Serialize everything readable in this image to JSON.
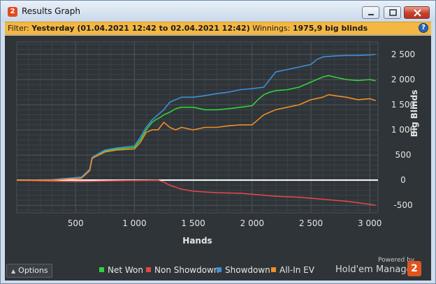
{
  "window": {
    "title": "Results Graph",
    "app_icon_glyph": "2",
    "app_icon_color": "#e24a1d",
    "controls": [
      "minimize-icon",
      "maximize-icon",
      "close-icon"
    ]
  },
  "filter": {
    "label": "Filter:",
    "value": "Yesterday (01.04.2021 12:42 to 02.04.2021 12:42)",
    "winnings_label": "Winnings:",
    "winnings_value": "1975,9 big blinds",
    "background_color": "#f3b844",
    "help_glyph": "?"
  },
  "options": {
    "label": "Options",
    "icon": "chevron-up-icon"
  },
  "branding": {
    "powered_by": "Powered by",
    "name": "Hold'em Manager",
    "logo_glyph": "2",
    "logo_color": "#e0541f"
  },
  "legend": [
    {
      "label": "Net Won",
      "color": "#34d13a"
    },
    {
      "label": "Non Showdown",
      "color": "#e0474c"
    },
    {
      "label": "Showdown",
      "color": "#3f8fd9"
    },
    {
      "label": "All-In EV",
      "color": "#ef8d2a"
    }
  ],
  "chart_data": {
    "type": "line",
    "xlabel": "Hands",
    "ylabel": "Big Blinds",
    "xlim": [
      0,
      3070
    ],
    "ylim": [
      -650,
      2750
    ],
    "x_ticks": [
      500,
      1000,
      1500,
      2000,
      2500,
      3000
    ],
    "x_tick_labels": [
      "500",
      "1 000",
      "1 500",
      "2 000",
      "2 500",
      "3 000"
    ],
    "y_ticks": [
      2500,
      2000,
      1500,
      1000,
      500,
      0,
      -500
    ],
    "y_tick_labels": [
      "2 500",
      "2 000",
      "1 500",
      "1 000",
      "500",
      "0",
      "-500"
    ],
    "y_axis_side": "right",
    "grid": true,
    "zero_line_color": "#ffffff",
    "background_color": "#2f3438",
    "series": [
      {
        "name": "Net Won",
        "color": "#34d13a",
        "x": [
          0,
          300,
          550,
          620,
          640,
          680,
          750,
          850,
          1000,
          1050,
          1100,
          1150,
          1180,
          1220,
          1250,
          1300,
          1350,
          1400,
          1500,
          1600,
          1700,
          1800,
          1900,
          2000,
          2050,
          2100,
          2150,
          2200,
          2300,
          2400,
          2500,
          2600,
          2650,
          2700,
          2800,
          2900,
          3000,
          3050
        ],
        "y": [
          0,
          0,
          50,
          200,
          450,
          500,
          580,
          620,
          650,
          800,
          1000,
          1150,
          1200,
          1250,
          1300,
          1350,
          1420,
          1450,
          1450,
          1400,
          1400,
          1420,
          1450,
          1480,
          1600,
          1700,
          1750,
          1780,
          1800,
          1850,
          1950,
          2050,
          2080,
          2050,
          2000,
          1980,
          2000,
          1976
        ]
      },
      {
        "name": "Non Showdown",
        "color": "#e0474c",
        "x": [
          0,
          300,
          550,
          700,
          900,
          1100,
          1200,
          1250,
          1300,
          1400,
          1500,
          1700,
          1900,
          2000,
          2100,
          2200,
          2300,
          2400,
          2500,
          2600,
          2700,
          2800,
          2900,
          3000,
          3050
        ],
        "y": [
          0,
          -20,
          -30,
          -20,
          -10,
          -5,
          0,
          -40,
          -100,
          -180,
          -220,
          -250,
          -260,
          -280,
          -300,
          -320,
          -330,
          -340,
          -360,
          -380,
          -400,
          -420,
          -450,
          -480,
          -500
        ]
      },
      {
        "name": "Showdown",
        "color": "#3f8fd9",
        "x": [
          0,
          300,
          550,
          620,
          640,
          680,
          750,
          850,
          1000,
          1050,
          1100,
          1150,
          1200,
          1250,
          1300,
          1350,
          1400,
          1500,
          1600,
          1700,
          1800,
          1900,
          2000,
          2100,
          2150,
          2200,
          2300,
          2400,
          2500,
          2550,
          2600,
          2700,
          2800,
          2900,
          3000,
          3050
        ],
        "y": [
          0,
          10,
          60,
          220,
          450,
          510,
          600,
          640,
          680,
          850,
          1050,
          1200,
          1300,
          1400,
          1550,
          1600,
          1650,
          1650,
          1680,
          1720,
          1750,
          1800,
          1820,
          1850,
          2000,
          2150,
          2200,
          2250,
          2300,
          2400,
          2450,
          2470,
          2480,
          2480,
          2490,
          2500
        ]
      },
      {
        "name": "All-In EV",
        "color": "#ef8d2a",
        "x": [
          0,
          300,
          550,
          620,
          640,
          680,
          750,
          850,
          1000,
          1050,
          1100,
          1150,
          1200,
          1250,
          1300,
          1350,
          1400,
          1500,
          1600,
          1700,
          1800,
          1900,
          2000,
          2050,
          2100,
          2200,
          2300,
          2400,
          2500,
          2600,
          2650,
          2700,
          2800,
          2900,
          3000,
          3050
        ],
        "y": [
          0,
          0,
          40,
          190,
          430,
          480,
          560,
          600,
          620,
          750,
          950,
          1000,
          1000,
          1150,
          1050,
          1000,
          1050,
          1000,
          1050,
          1050,
          1080,
          1100,
          1100,
          1200,
          1300,
          1400,
          1450,
          1500,
          1600,
          1650,
          1700,
          1680,
          1650,
          1600,
          1620,
          1580
        ]
      }
    ]
  }
}
